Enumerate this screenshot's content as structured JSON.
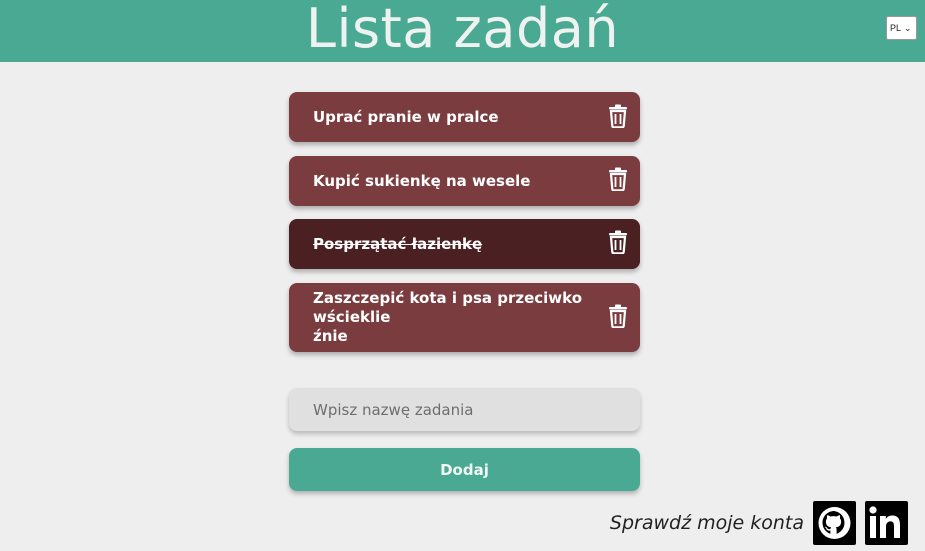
{
  "header": {
    "title": "Lista zadań",
    "language": {
      "selected": "PL"
    }
  },
  "tasks": [
    {
      "label": "Uprać pranie w pralce",
      "done": false
    },
    {
      "label": "Kupić sukienkę na wesele",
      "done": false
    },
    {
      "label": "Posprzątać łazienkę",
      "done": true
    },
    {
      "label": "Zaszczepić kota i psa przeciwko wścieklie",
      "label_line2": "źnie",
      "done": false
    }
  ],
  "form": {
    "placeholder": "Wpisz nazwę zadania",
    "value": "",
    "add_label": "Dodaj"
  },
  "footer": {
    "text": "Sprawdź moje konta",
    "links": [
      "github-icon",
      "linkedin-icon"
    ]
  },
  "colors": {
    "accent": "#4aa992",
    "task": "#7b3c3f",
    "task_done": "#4a2022",
    "background": "#eeeeee"
  }
}
